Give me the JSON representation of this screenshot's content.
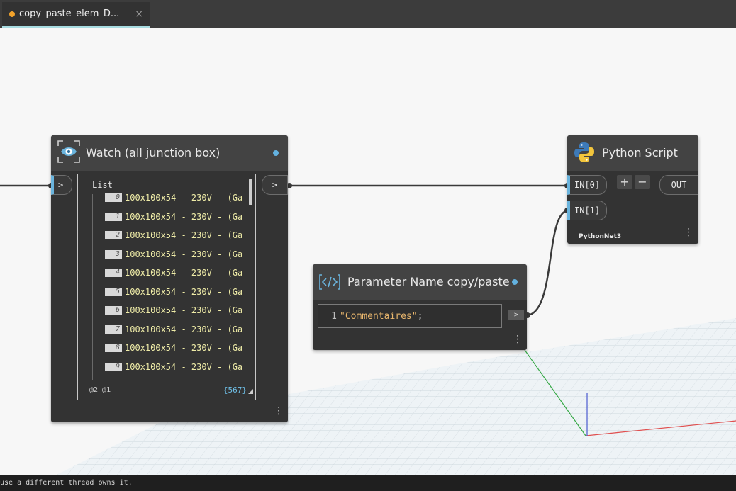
{
  "tab": {
    "title": "copy_paste_elem_D...",
    "close_glyph": "×",
    "modified_color": "#f3a32b"
  },
  "watch_node": {
    "title": "Watch (all junction box)",
    "input_port": ">",
    "output_port": ">",
    "list_label": "List",
    "items": [
      {
        "index": "0",
        "value": "100x100x54 - 230V - (Ga"
      },
      {
        "index": "1",
        "value": "100x100x54 - 230V - (Ga"
      },
      {
        "index": "2",
        "value": "100x100x54 - 230V - (Ga"
      },
      {
        "index": "3",
        "value": "100x100x54 - 230V - (Ga"
      },
      {
        "index": "4",
        "value": "100x100x54 - 230V - (Ga"
      },
      {
        "index": "5",
        "value": "100x100x54 - 230V - (Ga"
      },
      {
        "index": "6",
        "value": "100x100x54 - 230V - (Ga"
      },
      {
        "index": "7",
        "value": "100x100x54 - 230V - (Ga"
      },
      {
        "index": "8",
        "value": "100x100x54 - 230V - (Ga"
      },
      {
        "index": "9",
        "value": "100x100x54 - 230V - (Ga"
      }
    ],
    "levels": "@2 @1",
    "count": "{567}",
    "icon": "eye-icon"
  },
  "python_node": {
    "title": "Python Script",
    "inputs": [
      "IN[0]",
      "IN[1]"
    ],
    "add_label": "+",
    "remove_label": "−",
    "output": "OUT",
    "engine": "PythonNet3",
    "icon": "python-logo-icon"
  },
  "code_node": {
    "title": "Parameter Name copy/paste",
    "line_number": "1",
    "code_string": "\"Commentaires\"",
    "code_terminator": ";",
    "output_port": ">",
    "icon": "code-block-icon"
  },
  "status_bar": {
    "text": "use a different thread owns it."
  },
  "colors": {
    "accent": "#6ab4dd",
    "node_body": "#333333",
    "node_header": "#434343",
    "watch_values": "#f0eda8",
    "code_string": "#e8b66d"
  }
}
